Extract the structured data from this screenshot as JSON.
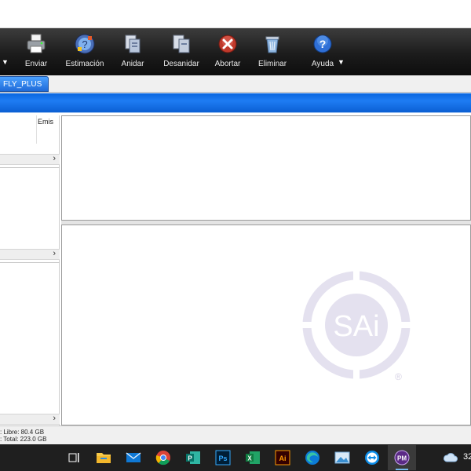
{
  "toolbar": {
    "dropdown_caret": "▼",
    "buttons": [
      {
        "label": "Enviar",
        "icon": "printer-icon"
      },
      {
        "label": "Estimación",
        "icon": "estimate-globe-icon"
      },
      {
        "label": "Anidar",
        "icon": "nest-document-icon"
      },
      {
        "label": "Desanidar",
        "icon": "unnest-document-icon"
      },
      {
        "label": "Abortar",
        "icon": "abort-x-icon"
      },
      {
        "label": "Eliminar",
        "icon": "trash-bin-icon"
      },
      {
        "label": "Ayuda",
        "icon": "help-question-icon"
      }
    ],
    "help_caret": "▼"
  },
  "tabs": [
    {
      "label": "FLY_PLUS",
      "active": true
    }
  ],
  "left_pane": {
    "column_header": "Emis",
    "section_chevron": "›"
  },
  "watermark": {
    "text": "SAi",
    "registered": "®",
    "color": "#e4e1ef"
  },
  "status": {
    "line1": ": Libre: 80.4 GB",
    "line2": ": Total: 223.0 GB"
  },
  "taskbar": {
    "icons": [
      "task-view-icon",
      "file-explorer-icon",
      "mail-icon",
      "chrome-icon",
      "publisher-icon",
      "photoshop-icon",
      "excel-icon",
      "illustrator-icon",
      "edge-icon",
      "photos-icon",
      "teamviewer-icon",
      "pm-app-icon",
      "weather-icon"
    ],
    "clock": "32"
  },
  "colors": {
    "toolbar_bg": "#1c1c1c",
    "accent_blue": "#1e7cf3",
    "tab_blue": "#2f86f0"
  }
}
